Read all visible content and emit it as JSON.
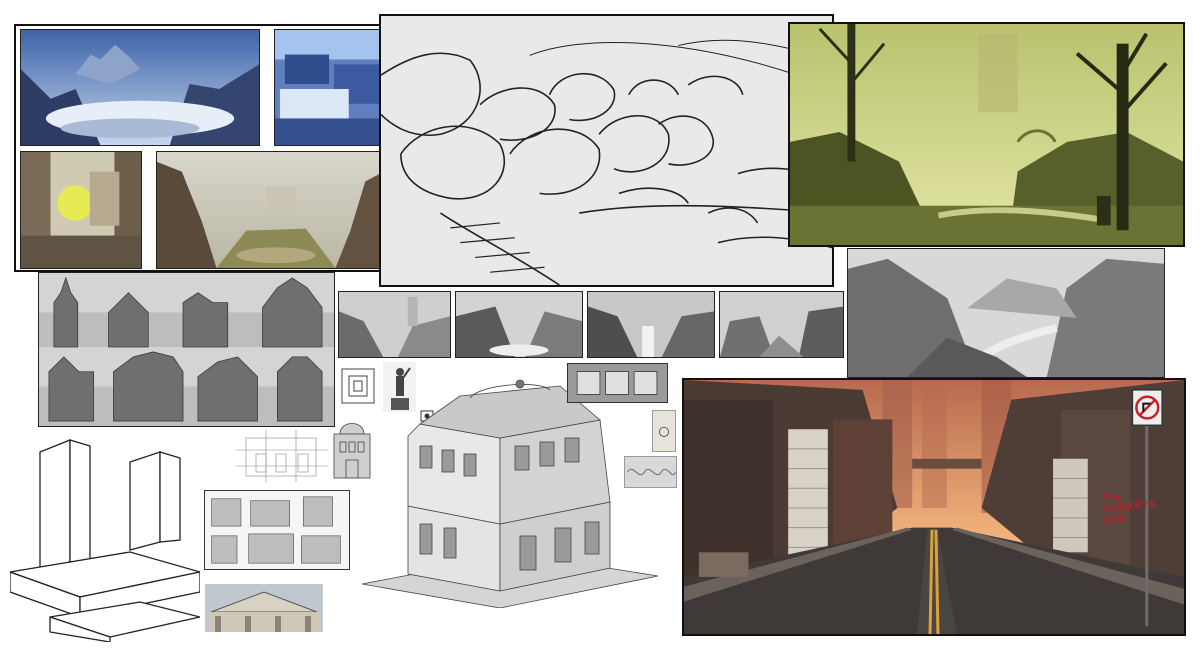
{
  "board": {
    "background": "#ffffff",
    "panels": [
      {
        "name": "concept-thumbnails",
        "palette": [
          "#3e5a8a",
          "#b7c9e6",
          "#6d84b6",
          "#d6c98c"
        ]
      },
      {
        "name": "line-sketch",
        "palette": [
          "#e9e9e9",
          "#222222"
        ]
      },
      {
        "name": "swamp-painting",
        "palette": [
          "#8d9a45",
          "#c9cf7a",
          "#3b3f1d"
        ]
      },
      {
        "name": "building-silhouettes",
        "palette": [
          "#7a7a7a",
          "#d6d6d6"
        ]
      },
      {
        "name": "grey-value-studies",
        "palette": [
          "#5f5f5f",
          "#bdbdbd"
        ]
      },
      {
        "name": "grey-canyon-study",
        "palette": [
          "#6a6a6a",
          "#cfcfcf"
        ]
      },
      {
        "name": "perspective-blocks",
        "palette": [
          "#ffffff",
          "#222222"
        ]
      },
      {
        "name": "ornate-building-model",
        "palette": [
          "#d9d9d9",
          "#555555"
        ]
      },
      {
        "name": "city-street-painting",
        "palette": [
          "#d98a5a",
          "#4a3a34",
          "#f2b27c"
        ]
      }
    ]
  },
  "street": {
    "graffiti": "THE MONKEYS ARE"
  }
}
